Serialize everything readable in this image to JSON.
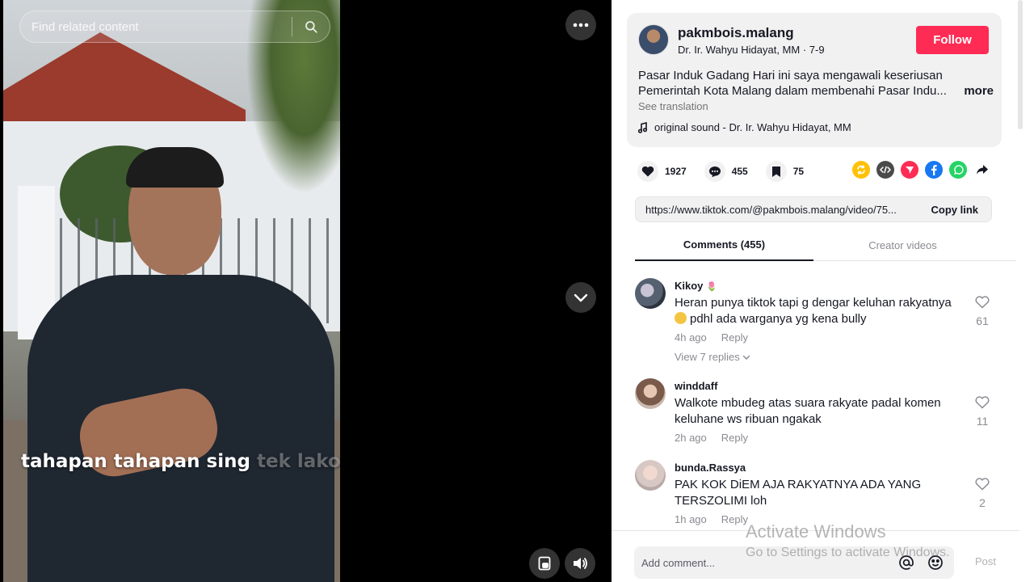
{
  "video": {
    "search": {
      "placeholder": "Find related content",
      "icon": "search-icon"
    },
    "caption": {
      "main": "tahapan tahapan sing",
      "faded": " tek lakon"
    },
    "controls": {
      "more_icon": "ellipsis-icon",
      "next_icon": "chevron-down-icon",
      "pip_icon": "picture-in-picture-icon",
      "volume_icon": "volume-icon"
    }
  },
  "post": {
    "username": "pakmbois.malang",
    "display_name": "Dr. Ir. Wahyu Hidayat, MM",
    "date": "7-9",
    "follow_label": "Follow",
    "description_line1": "Pasar Induk Gadang Hari ini saya mengawali keseriusan",
    "description_line2": "Pemerintah Kota Malang dalam membenahi Pasar Indu...",
    "more_label": "more",
    "see_translation": "See translation",
    "sound": "original sound - Dr. Ir. Wahyu Hidayat, MM"
  },
  "stats": {
    "likes": "1927",
    "comments": "455",
    "saves": "75"
  },
  "share_colors": {
    "repost": "#ffc107",
    "embed": "#4a4a4a",
    "send": "#fe2c55",
    "facebook": "#1877f2",
    "whatsapp": "#25d366"
  },
  "link": {
    "url": "https://www.tiktok.com/@pakmbois.malang/video/75...",
    "copy_label": "Copy link"
  },
  "tabs": [
    {
      "label": "Comments (455)"
    },
    {
      "label": "Creator videos"
    }
  ],
  "comments": [
    {
      "user": "Kikoy",
      "text_line1": "Heran punya tiktok tapi g dengar keluhan rakyatnya",
      "text_line2": "pdhl ada warganya yg kena bully",
      "time": "4h ago",
      "reply_label": "Reply",
      "likes": "61",
      "view_replies": "View 7 replies"
    },
    {
      "user": "winddaff",
      "text_line1": "Walkote mbudeg atas suara rakyate padal komen",
      "text_line2": "keluhane ws ribuan ngakak",
      "time": "2h ago",
      "reply_label": "Reply",
      "likes": "11"
    },
    {
      "user": "bunda.Rassya",
      "text_line1": "PAK KOK DiEM AJA RAKYATNYA ADA YANG",
      "text_line2": "TERSZOLIMI loh",
      "time": "1h ago",
      "reply_label": "Reply",
      "likes": "2"
    }
  ],
  "composer": {
    "placeholder": "Add comment...",
    "post_label": "Post"
  },
  "watermark": {
    "title": "Activate Windows",
    "subtitle": "Go to Settings to activate Windows."
  },
  "colors": {
    "accent": "#fe2c55",
    "panel_bg": "#ffffff",
    "card_bg": "#f1f1f2"
  }
}
